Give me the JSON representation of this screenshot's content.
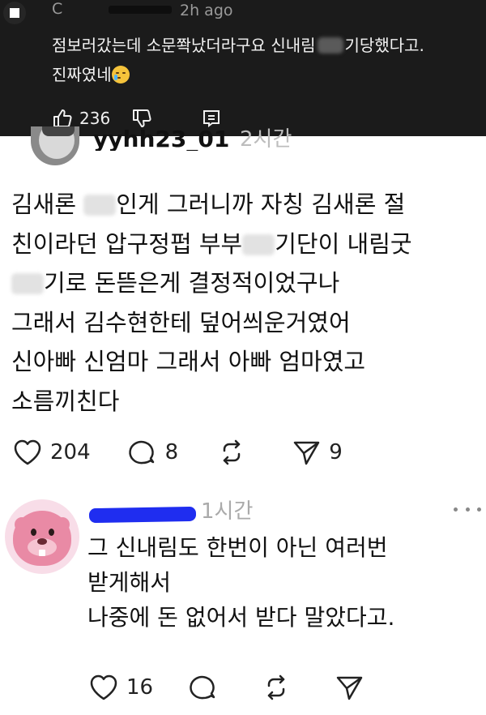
{
  "embedded_comment": {
    "username": "C",
    "time": "2h ago",
    "text_line1_a": "점보러갔는데 소문쫙났더라구요 신내림",
    "text_line1_b": "기당했다고.",
    "text_line2": "진짜였네",
    "like_count": "236",
    "icons": [
      "avatar-icon",
      "thumbs-up-icon",
      "thumbs-down-icon",
      "reply-icon",
      "crying-emoji"
    ]
  },
  "post": {
    "username": "yyhh23_01",
    "time": "2시간",
    "text_lines": {
      "l1_a": "김새론",
      "l1_b": "인게 그러니까 자칭 김새론 절",
      "l2_a": "친이라던 압구정펍 부부",
      "l2_b": "기단이 내림굿",
      "l3": "기로 돈뜯은게 결정적이었구나",
      "l4": "그래서 김수현한테 덮어씌운거였어",
      "l5": "신아빠 신엄마 그래서 아빠 엄마였고",
      "l6": "소름끼친다"
    },
    "like_count": "204",
    "reply_count": "8",
    "repost_count": "",
    "share_count": "9"
  },
  "comment": {
    "username": "",
    "time": "1시간",
    "text_lines": [
      "그 신내림도 한번이 아닌 여러번",
      "받게해서",
      "나중에 돈 없어서 받다 말았다고."
    ],
    "like_count": "16"
  },
  "colors": {
    "dark_bg": "#1b1b1b",
    "scribble_blue": "#1f2df0",
    "avatar_pink": "#e98aa5"
  }
}
